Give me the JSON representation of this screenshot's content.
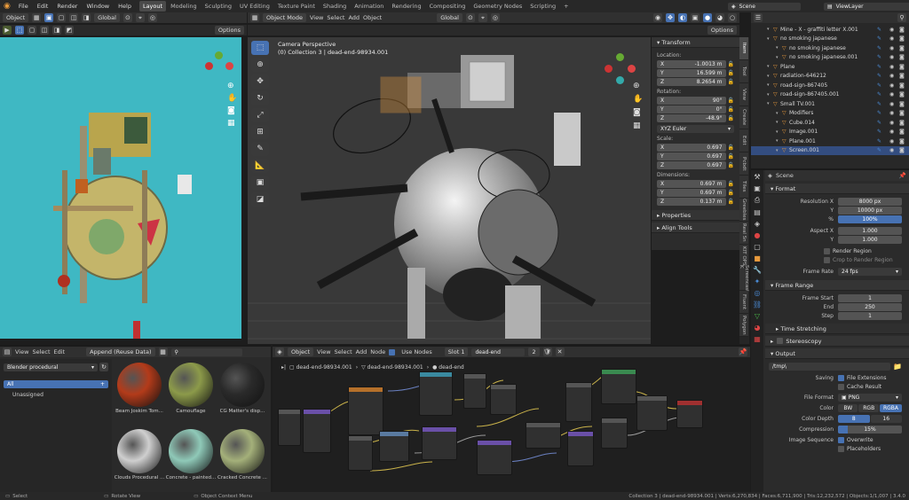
{
  "app": {
    "menus": [
      "File",
      "Edit",
      "Render",
      "Window",
      "Help"
    ],
    "workspaces": [
      "Layout",
      "Modeling",
      "Sculpting",
      "UV Editing",
      "Texture Paint",
      "Shading",
      "Animation",
      "Rendering",
      "Compositing",
      "Geometry Nodes",
      "Scripting"
    ],
    "active_workspace": "Layout",
    "scene": "Scene",
    "view_layer": "ViewLayer"
  },
  "left_viewport": {
    "mode": "Object",
    "orientation": "Global",
    "options": "Options"
  },
  "main_viewport": {
    "mode": "Object Mode",
    "menus": [
      "View",
      "Select",
      "Add",
      "Object"
    ],
    "orientation": "Global",
    "options": "Options",
    "overlay_line1": "Camera Perspective",
    "overlay_line2": "(0) Collection 3 | dead-end-98934.001"
  },
  "transform_panel": {
    "title": "Transform",
    "location_label": "Location:",
    "location": [
      {
        "axis": "X",
        "value": "-1.0013 m"
      },
      {
        "axis": "Y",
        "value": "16.599 m"
      },
      {
        "axis": "Z",
        "value": "8.2654 m"
      }
    ],
    "rotation_label": "Rotation:",
    "rotation": [
      {
        "axis": "X",
        "value": "90°"
      },
      {
        "axis": "Y",
        "value": "0°"
      },
      {
        "axis": "Z",
        "value": "-48.9°"
      }
    ],
    "rotation_mode": "XYZ Euler",
    "scale_label": "Scale:",
    "scale": [
      {
        "axis": "X",
        "value": "0.697"
      },
      {
        "axis": "Y",
        "value": "0.697"
      },
      {
        "axis": "Z",
        "value": "0.697"
      }
    ],
    "dimensions_label": "Dimensions:",
    "dimensions": [
      {
        "axis": "X",
        "value": "0.697 m"
      },
      {
        "axis": "Y",
        "value": "0.697 m"
      },
      {
        "axis": "Z",
        "value": "0.137 m"
      }
    ],
    "properties": "Properties",
    "align_tools": "Align Tools"
  },
  "side_tabs": [
    "Item",
    "Tool",
    "View",
    "Create",
    "Edit",
    "Pcbdt",
    "Tiles",
    "Greebles",
    "Real Sn",
    "KIT OPS",
    "Screencast K",
    "Fluent",
    "Polygon"
  ],
  "outliner": {
    "items": [
      {
        "label": "Mine - X - graffiti letter X.001",
        "depth": 1
      },
      {
        "label": "no smoking japanese",
        "depth": 1
      },
      {
        "label": "no smoking japanese",
        "depth": 2
      },
      {
        "label": "no smoking japanese.001",
        "depth": 2
      },
      {
        "label": "Plane",
        "depth": 1
      },
      {
        "label": "radiation-646212",
        "depth": 1
      },
      {
        "label": "road-sign-867405",
        "depth": 1
      },
      {
        "label": "road-sign-867405.001",
        "depth": 1
      },
      {
        "label": "Small TV.001",
        "depth": 1
      },
      {
        "label": "Modifiers",
        "depth": 2
      },
      {
        "label": "Cube.014",
        "depth": 2
      },
      {
        "label": "Image.001",
        "depth": 2
      },
      {
        "label": "Plane.001",
        "depth": 2
      },
      {
        "label": "Screen.001",
        "depth": 2
      }
    ]
  },
  "properties": {
    "context": "Scene",
    "format_title": "Format",
    "resolution_x_label": "Resolution X",
    "resolution_x": "8000 px",
    "resolution_y_label": "Y",
    "resolution_y": "10000 px",
    "percent_label": "%",
    "percent": "100%",
    "aspect_x_label": "Aspect X",
    "aspect_x": "1.000",
    "aspect_y_label": "Y",
    "aspect_y": "1.000",
    "render_region": "Render Region",
    "crop_region": "Crop to Render Region",
    "frame_rate_label": "Frame Rate",
    "frame_rate": "24 fps",
    "frame_range_title": "Frame Range",
    "frame_start_label": "Frame Start",
    "frame_start": "1",
    "end_label": "End",
    "end": "250",
    "step_label": "Step",
    "step": "1",
    "time_stretching": "Time Stretching",
    "stereoscopy": "Stereoscopy",
    "output_title": "Output",
    "output_path": "/tmp\\",
    "saving_label": "Saving",
    "file_extensions": "File Extensions",
    "cache_result": "Cache Result",
    "file_format_label": "File Format",
    "file_format": "PNG",
    "color_label": "Color",
    "color_options": [
      "BW",
      "RGB",
      "RGBA"
    ],
    "color_active": "RGBA",
    "color_depth_label": "Color Depth",
    "color_depth_options": [
      "8",
      "16"
    ],
    "compression_label": "Compression",
    "compression": "15%",
    "compression_fraction": 0.15,
    "image_sequence_label": "Image Sequence",
    "overwrite": "Overwrite",
    "placeholders": "Placeholders"
  },
  "asset_browser": {
    "menus": [
      "View",
      "Select",
      "Edit"
    ],
    "import_mode": "Append (Reuse Data)",
    "library": "Blender procedural",
    "catalog_all": "All",
    "catalog_unassigned": "Unassigned",
    "assets": [
      {
        "label": "Beam Joskim Tom...",
        "color": "#b33b1a"
      },
      {
        "label": "Camouflage",
        "color": "#8c9a4a"
      },
      {
        "label": "CG Matter's disp...",
        "color": "#2a2a2a"
      },
      {
        "label": "Clouds Procedural ...",
        "color": "#cfcfcf"
      },
      {
        "label": "Concrete - painted...",
        "color": "#8fc9b8"
      },
      {
        "label": "Cracked Concrete ...",
        "color": "#a4b07a"
      }
    ]
  },
  "node_editor": {
    "type": "Object",
    "menus": [
      "View",
      "Select",
      "Add",
      "Node"
    ],
    "use_nodes": "Use Nodes",
    "slot": "Slot 1",
    "material": "dead-end",
    "users": "2",
    "breadcrumb": [
      "dead-end-98934.001",
      "dead-end-98934.001",
      "dead-end"
    ]
  },
  "status_bar": {
    "select": "Select",
    "rotate": "Rotate View",
    "context_menu": "Object Context Menu",
    "stats": "Collection 3 | dead-end-98934.001 | Verts:6,270,834 | Faces:6,711,900 | Tris:12,232,572 | Objects:1/1,007 | 3.4.0"
  },
  "colors": {
    "accent": "#4772b3",
    "object_orange": "#e89a3c",
    "bg": "#1d1d1d",
    "panel": "#2c2c2c",
    "viewport_cyan": "#3fb8c3"
  }
}
